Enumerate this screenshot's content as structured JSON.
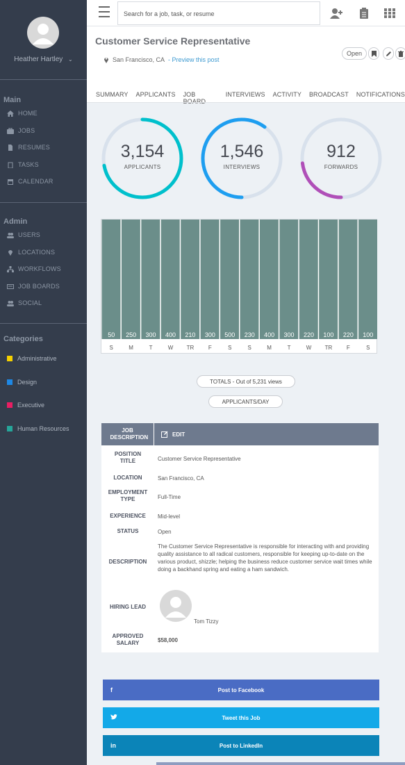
{
  "user": {
    "name": "Heather Hartley"
  },
  "sidebar": {
    "main_title": "Main",
    "main_items": [
      {
        "label": "HOME",
        "icon": "home-icon"
      },
      {
        "label": "JOBS",
        "icon": "briefcase-icon"
      },
      {
        "label": "RESUMES",
        "icon": "document-icon"
      },
      {
        "label": "TASKS",
        "icon": "clipboard-icon"
      },
      {
        "label": "CALENDAR",
        "icon": "calendar-icon"
      }
    ],
    "admin_title": "Admin",
    "admin_items": [
      {
        "label": "USERS",
        "icon": "users-icon"
      },
      {
        "label": "LOCATIONS",
        "icon": "map-pin-icon"
      },
      {
        "label": "WORKFLOWS",
        "icon": "sitemap-icon"
      },
      {
        "label": "JOB BOARDS",
        "icon": "board-icon"
      },
      {
        "label": "SOCIAL",
        "icon": "social-icon"
      }
    ],
    "categories_title": "Categories",
    "categories": [
      {
        "label": "Administrative",
        "color": "#f5d000"
      },
      {
        "label": "Design",
        "color": "#1e88e5"
      },
      {
        "label": "Executive",
        "color": "#e91e63"
      },
      {
        "label": "Human Resources",
        "color": "#26a69a"
      }
    ]
  },
  "search": {
    "placeholder": "Search for a job, task, or resume"
  },
  "job": {
    "title": "Customer Service Representative",
    "location": "San Francisco, CA",
    "preview_link": "- Preview this post",
    "status_pill": "Open"
  },
  "tabs": [
    "SUMMARY",
    "APPLICANTS",
    "JOB BOARD",
    "INTERVIEWS",
    "ACTIVITY",
    "BROADCAST",
    "NOTIFICATIONS"
  ],
  "stats": [
    {
      "value": "3,154",
      "label": "APPLICANTS",
      "fraction": 0.72,
      "color": "#00c0cc"
    },
    {
      "value": "1,546",
      "label": "INTERVIEWS",
      "fraction": 0.6,
      "color": "#1e9ef0"
    },
    {
      "value": "912",
      "label": "FORWARDS",
      "fraction": 0.23,
      "color": "#b04fb8"
    }
  ],
  "chart_data": {
    "type": "bar",
    "categories": [
      "S",
      "M",
      "T",
      "W",
      "TR",
      "F",
      "S",
      "S",
      "M",
      "T",
      "W",
      "TR",
      "F",
      "S"
    ],
    "values": [
      50,
      250,
      300,
      400,
      210,
      300,
      500,
      230,
      400,
      300,
      220,
      100,
      220,
      100
    ],
    "bar_color": "#6b8e8a"
  },
  "totals_label": "TOTALS - Out of 5,231 views",
  "applicants_day_label": "APPLICANTS/DAY",
  "jd": {
    "header": "JOB DESCRIPTION",
    "edit": "EDIT",
    "rows": [
      {
        "label": "POSITION TITLE",
        "value": "Customer Service Representative"
      },
      {
        "label": "LOCATION",
        "value": "San Francisco, CA"
      },
      {
        "label": "EMPLOYMENT TYPE",
        "value": "Full-Time"
      },
      {
        "label": "EXPERIENCE",
        "value": "Mid-level"
      },
      {
        "label": "STATUS",
        "value": "Open"
      },
      {
        "label": "DESCRIPTION",
        "value": "The Customer Service Representative is responsible for interacting with and providing quality assistance to all radical customers, responsible for keeping up-to-date on the various product, shizzle; helping the business reduce customer service wait times while doing a backhand spring and eating a ham sandwich."
      },
      {
        "label": "HIRING LEAD",
        "value": "Tom Tizzy"
      },
      {
        "label": "APPROVED SALARY",
        "value": "$58,000"
      }
    ]
  },
  "social": [
    {
      "label": "Post to Facebook",
      "icon": "f",
      "color": "#4a6cc4"
    },
    {
      "label": "Tweet this Job",
      "icon": "t",
      "color": "#13a9e8"
    },
    {
      "label": "Post to LinkedIn",
      "icon": "in",
      "color": "#0b84b8"
    }
  ]
}
